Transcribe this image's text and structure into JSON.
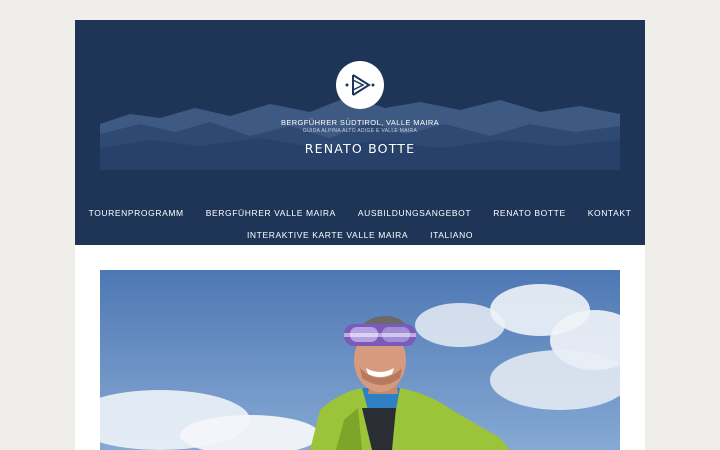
{
  "header": {
    "tagline_main": "BERGFÜHRER SÜDTIROL, VALLE MAIRA",
    "tagline_sub": "GUIDA ALPINA ALTO ADIGE E VALLE MAIRA",
    "site_title": "RENATO BOTTE",
    "logo_icon": "play-triangle-logo-icon",
    "colors": {
      "header_bg": "#1f3558",
      "page_bg": "#efeeeb",
      "text": "#ffffff"
    }
  },
  "nav": {
    "row1": [
      "TOURENPROGRAMM",
      "BERGFÜHRER VALLE MAIRA",
      "AUSBILDUNGSANGEBOT",
      "RENATO BOTTE",
      "KONTAKT"
    ],
    "row2": [
      "INTERAKTIVE KARTE VALLE MAIRA",
      "ITALIANO"
    ]
  },
  "hero": {
    "image": "portrait of a smiling mountain guide with ski goggles and a bright green jacket against a blue sky"
  }
}
